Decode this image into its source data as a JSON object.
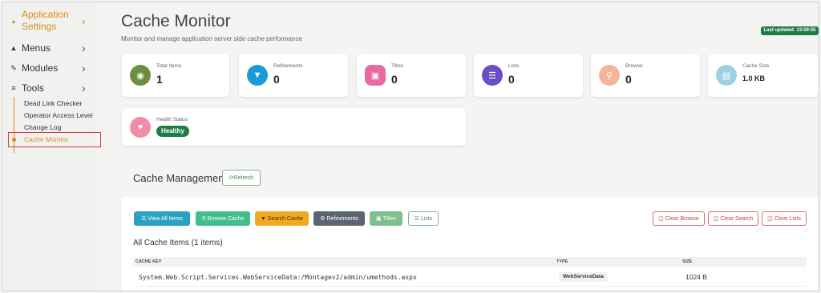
{
  "sidebar": {
    "app_settings_label": "Application Settings",
    "items": [
      {
        "label": "Menus",
        "icon": "hat-icon"
      },
      {
        "label": "Modules",
        "icon": "edit-icon"
      },
      {
        "label": "Tools",
        "icon": "tools-icon"
      }
    ],
    "tools_subitems": [
      "Dead Link Checker",
      "Operator Access Level",
      "Change Log",
      "Cache Monitor"
    ],
    "active_subitem": "Cache Monitor",
    "accent_color": "#d98e1a"
  },
  "header": {
    "title": "Cache Monitor",
    "subtitle": "Monitor and manage application server side cache performance",
    "last_updated": "Last updated: 13:59:55"
  },
  "stats": [
    {
      "label": "Total Items",
      "value": "1",
      "icon": "database-icon",
      "color": "#6a8f3f"
    },
    {
      "label": "Refinements",
      "value": "0",
      "icon": "filter-icon",
      "color": "#1a9bd7"
    },
    {
      "label": "Titles",
      "value": "0",
      "icon": "book-icon",
      "color": "#e86aa0"
    },
    {
      "label": "Lists",
      "value": "0",
      "icon": "list-icon",
      "color": "#6a4cc9"
    },
    {
      "label": "Browse",
      "value": "0",
      "icon": "search-icon",
      "color": "#f3b49a"
    },
    {
      "label": "Cache Size",
      "value": "1.0 KB",
      "icon": "memory-icon",
      "color": "#9fd0e0"
    }
  ],
  "health": {
    "label": "Health Status",
    "value": "Healthy",
    "icon": "heart-pulse-icon",
    "color": "#f08ca8"
  },
  "management": {
    "title": "Cache Management",
    "refresh_label": "Refresh",
    "buttons": [
      {
        "label": "View All Items",
        "color": "#2aa3c2"
      },
      {
        "label": "Browse Cache",
        "color": "#3fbf8a"
      },
      {
        "label": "Search Cache",
        "color": "#f2a91e"
      },
      {
        "label": "Refinements",
        "color": "#5b6570"
      },
      {
        "label": "Titles",
        "color": "#7cc08f"
      },
      {
        "label": "Lists",
        "color": "#ffffff"
      }
    ],
    "clear_buttons": [
      "Clear Browse",
      "Clear Search",
      "Clear Lists"
    ],
    "list_title": "All Cache Items (1 items)",
    "columns": [
      "CACHE KEY",
      "TYPE",
      "SIZE"
    ],
    "rows": [
      {
        "key": "System.Web.Script.Services.WebServiceData:/Montagev2/admin/umethods.aspx",
        "type": "WebServiceData",
        "size": "1024 B"
      }
    ]
  }
}
